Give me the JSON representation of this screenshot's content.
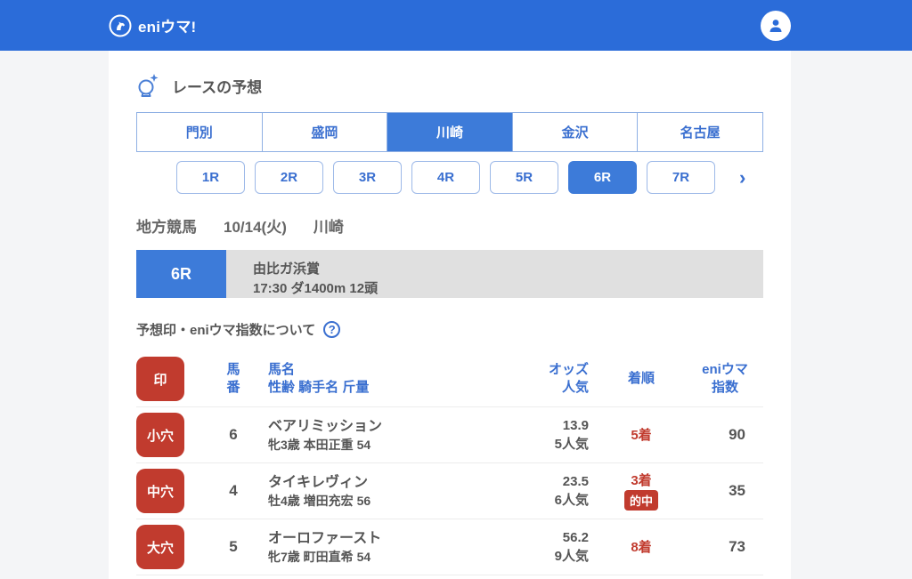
{
  "colors": {
    "brand_blue": "#2b6cd9",
    "selected_blue": "#3d7bd9",
    "accent_red": "#c13b2e",
    "banner_gray": "#e0e0e0"
  },
  "appbar": {
    "logo_text": "eniウマ!"
  },
  "prediction": {
    "title": "レースの予想",
    "tracks": [
      {
        "label": "門別"
      },
      {
        "label": "盛岡"
      },
      {
        "label": "川崎"
      },
      {
        "label": "金沢"
      },
      {
        "label": "名古屋"
      }
    ],
    "selected_track": "川崎",
    "races": [
      {
        "label": "1R"
      },
      {
        "label": "2R"
      },
      {
        "label": "3R"
      },
      {
        "label": "4R"
      },
      {
        "label": "5R"
      },
      {
        "label": "6R"
      },
      {
        "label": "7R"
      }
    ],
    "selected_race": "6R",
    "next_chevron": "›",
    "meta": {
      "category": "地方競馬",
      "date": "10/14(火)",
      "track": "川崎"
    },
    "banner": {
      "race_no": "6R",
      "race_name": "由比ガ浜賞",
      "race_details": "17:30 ダ1400m 12頭"
    },
    "about_label": "予想印・eniウマ指数について",
    "help_glyph": "?"
  },
  "table": {
    "headers": {
      "mark": "印",
      "number_l1": "馬",
      "number_l2": "番",
      "name_l1": "馬名",
      "name_l2": "性齢  騎手名  斤量",
      "odds_l1": "オッズ",
      "odds_l2": "人気",
      "rank": "着順",
      "index_l1": "eniウマ",
      "index_l2": "指数"
    },
    "rows": [
      {
        "mark": "小穴",
        "number": "6",
        "name": "ベアリミッション",
        "profile": "牝3歳 本田正重 54",
        "odds": "13.9",
        "popularity": "5人気",
        "rank": "5着",
        "hit": "",
        "index": "90"
      },
      {
        "mark": "中穴",
        "number": "4",
        "name": "タイキレヴィン",
        "profile": "牡4歳 増田充宏 56",
        "odds": "23.5",
        "popularity": "6人気",
        "rank": "3着",
        "hit": "的中",
        "index": "35"
      },
      {
        "mark": "大穴",
        "number": "5",
        "name": "オーロファースト",
        "profile": "牝7歳 町田直希 54",
        "odds": "56.2",
        "popularity": "9人気",
        "rank": "8着",
        "hit": "",
        "index": "73"
      }
    ]
  }
}
